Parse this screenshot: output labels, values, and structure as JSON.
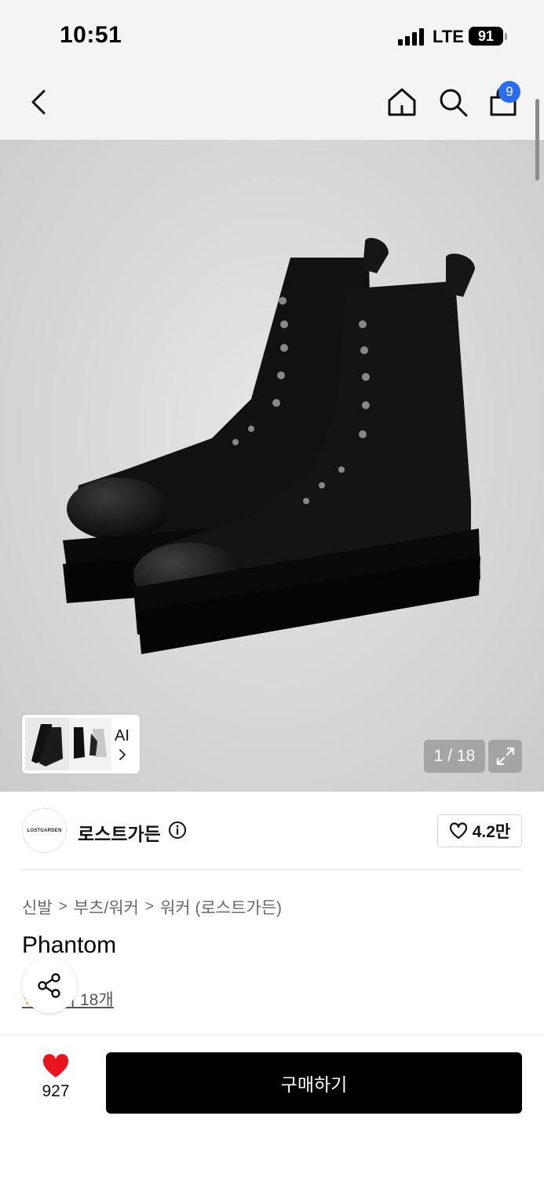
{
  "status_bar": {
    "time": "10:51",
    "network": "LTE",
    "battery": "91"
  },
  "nav": {
    "back_icon": "chevron-left-icon",
    "home_icon": "home-icon",
    "search_icon": "search-icon",
    "cart_icon": "shopping-bag-icon",
    "cart_badge": "9",
    "badge_color": "#2a6df4"
  },
  "gallery": {
    "ai_label": "AI",
    "counter": "1 / 18",
    "expand_icon": "expand-icon"
  },
  "brand": {
    "logo_text": "LOSTGARDEN",
    "name": "로스트가든",
    "info_icon": "info-icon",
    "like_icon": "heart-outline-icon",
    "like_count": "4.2만"
  },
  "breadcrumb": {
    "items": [
      "신발",
      "부츠/워커",
      "워커 (로스트가든)"
    ],
    "separator": ">"
  },
  "product": {
    "title": "Phantom",
    "review_text": "기 18개"
  },
  "share": {
    "icon": "share-icon"
  },
  "bottom_bar": {
    "wish_icon": "heart-filled-icon",
    "wish_color": "#e8141f",
    "wish_count": "927",
    "buy_label": "구매하기"
  }
}
